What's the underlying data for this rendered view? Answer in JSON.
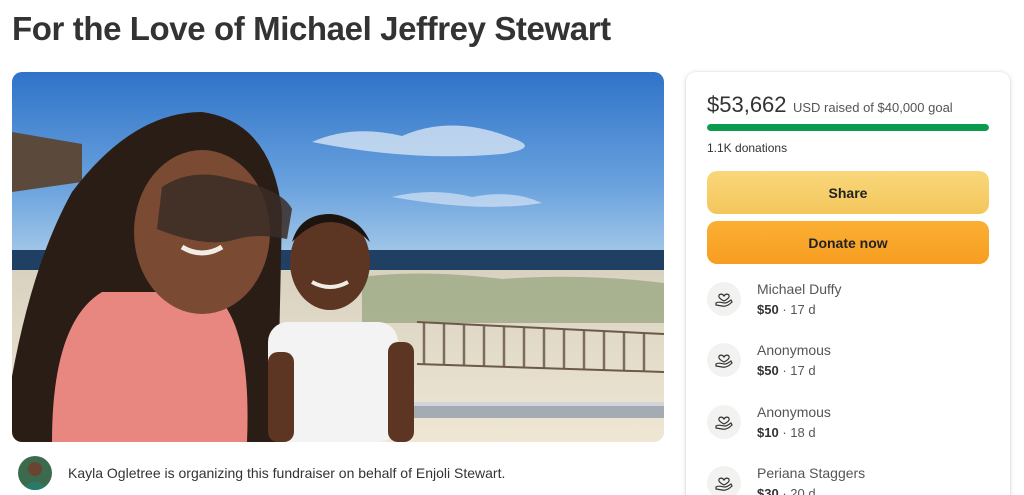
{
  "page": {
    "title": "For the Love of Michael Jeffrey Stewart"
  },
  "organizer": {
    "text": "Kayla Ogletree is organizing this fundraiser on behalf of Enjoli Stewart."
  },
  "fundraiser": {
    "raised_amount": "$53,662",
    "raised_rest": "USD raised of $40,000 goal",
    "progress_fraction": 1.0,
    "donation_count": "1.1K donations",
    "share_label": "Share",
    "donate_label": "Donate now",
    "progress_color": "#0b9b4e"
  },
  "donors": [
    {
      "name": "Michael Duffy",
      "amount": "$50",
      "time": " · 17 d",
      "icon": "heart-hand-icon"
    },
    {
      "name": "Anonymous",
      "amount": "$50",
      "time": " · 17 d",
      "icon": "heart-hand-icon"
    },
    {
      "name": "Anonymous",
      "amount": "$10",
      "time": " · 18 d",
      "icon": "heart-hand-icon"
    },
    {
      "name": "Periana Staggers",
      "amount": "$30",
      "time": " · 20 d",
      "icon": "heart-hand-icon"
    }
  ]
}
